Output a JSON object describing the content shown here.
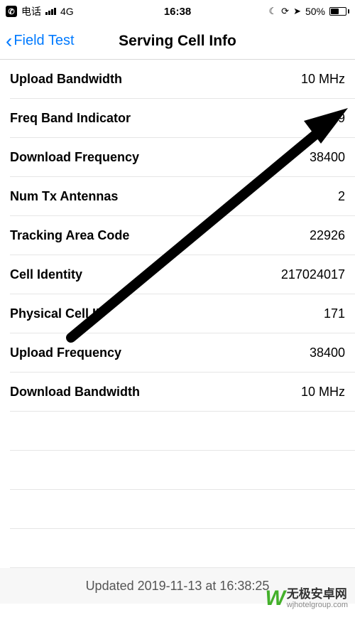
{
  "status": {
    "carrier": "电话",
    "network": "4G",
    "time": "16:38",
    "battery_percent": "50%"
  },
  "nav": {
    "back_label": "Field Test",
    "title": "Serving Cell Info"
  },
  "rows": [
    {
      "label": "Upload Bandwidth",
      "value": "10 MHz"
    },
    {
      "label": "Freq Band Indicator",
      "value": "39"
    },
    {
      "label": "Download Frequency",
      "value": "38400"
    },
    {
      "label": "Num Tx Antennas",
      "value": "2"
    },
    {
      "label": "Tracking Area Code",
      "value": "22926"
    },
    {
      "label": "Cell Identity",
      "value": "217024017"
    },
    {
      "label": "Physical Cell ID",
      "value": "171"
    },
    {
      "label": "Upload Frequency",
      "value": "38400"
    },
    {
      "label": "Download Bandwidth",
      "value": "10 MHz"
    }
  ],
  "footer": {
    "updated": "Updated 2019-11-13 at 16:38:25"
  },
  "watermark": {
    "logo": "W",
    "cn": "无极安卓网",
    "url": "wjhotelgroup.com"
  }
}
